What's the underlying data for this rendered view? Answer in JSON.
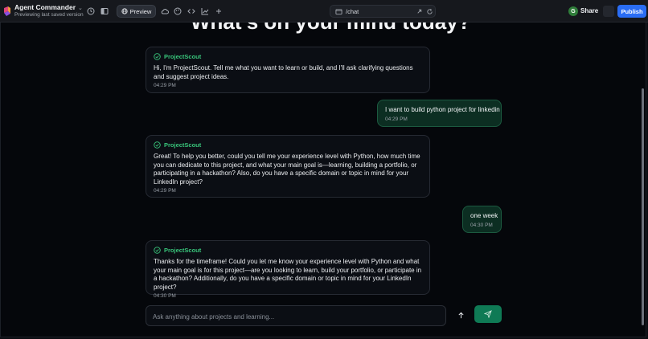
{
  "header": {
    "app_name": "Agent Commander",
    "app_subtitle": "Previewing last saved version",
    "preview_label": "Preview",
    "url": "/chat",
    "avatar_initial": "G",
    "share_label": "Share",
    "publish_label": "Publish"
  },
  "chat": {
    "heading": "What's on your mind today?",
    "messages": [
      {
        "role": "bot",
        "sender": "ProjectScout",
        "text": "Hi, I'm ProjectScout. Tell me what you want to learn or build, and I'll ask clarifying questions and suggest project ideas.",
        "time": "04:29 PM"
      },
      {
        "role": "user",
        "text": "I want to build python project for linkedin",
        "time": "04:29 PM"
      },
      {
        "role": "bot",
        "sender": "ProjectScout",
        "text": "Great! To help you better, could you tell me your experience level with Python, how much time you can dedicate to this project, and what your main goal is—learning, building a portfolio, or participating in a hackathon? Also, do you have a specific domain or topic in mind for your LinkedIn project?",
        "time": "04:29 PM"
      },
      {
        "role": "user",
        "text": "one week",
        "time": "04:30 PM"
      },
      {
        "role": "bot",
        "sender": "ProjectScout",
        "text": "Thanks for the timeframe! Could you let me know your experience level with Python and what your main goal is for this project—are you looking to learn, build your portfolio, or participate in a hackathon? Additionally, do you have a specific domain or topic in mind for your LinkedIn project?",
        "time": "04:30 PM"
      }
    ]
  },
  "composer": {
    "placeholder": "Ask anything about projects and learning..."
  },
  "colors": {
    "accent_green": "#38c47a",
    "user_bubble": "#0c2e22",
    "publish_blue": "#2a6df4",
    "send_button": "#0f7a55"
  },
  "icons": [
    "history-icon",
    "panel-icon",
    "globe-icon",
    "cloud-icon",
    "palette-icon",
    "code-icon",
    "chart-icon",
    "plus-icon",
    "browser-icon",
    "external-link-icon",
    "refresh-icon",
    "check-circle-icon",
    "arrow-up-icon",
    "send-icon"
  ]
}
